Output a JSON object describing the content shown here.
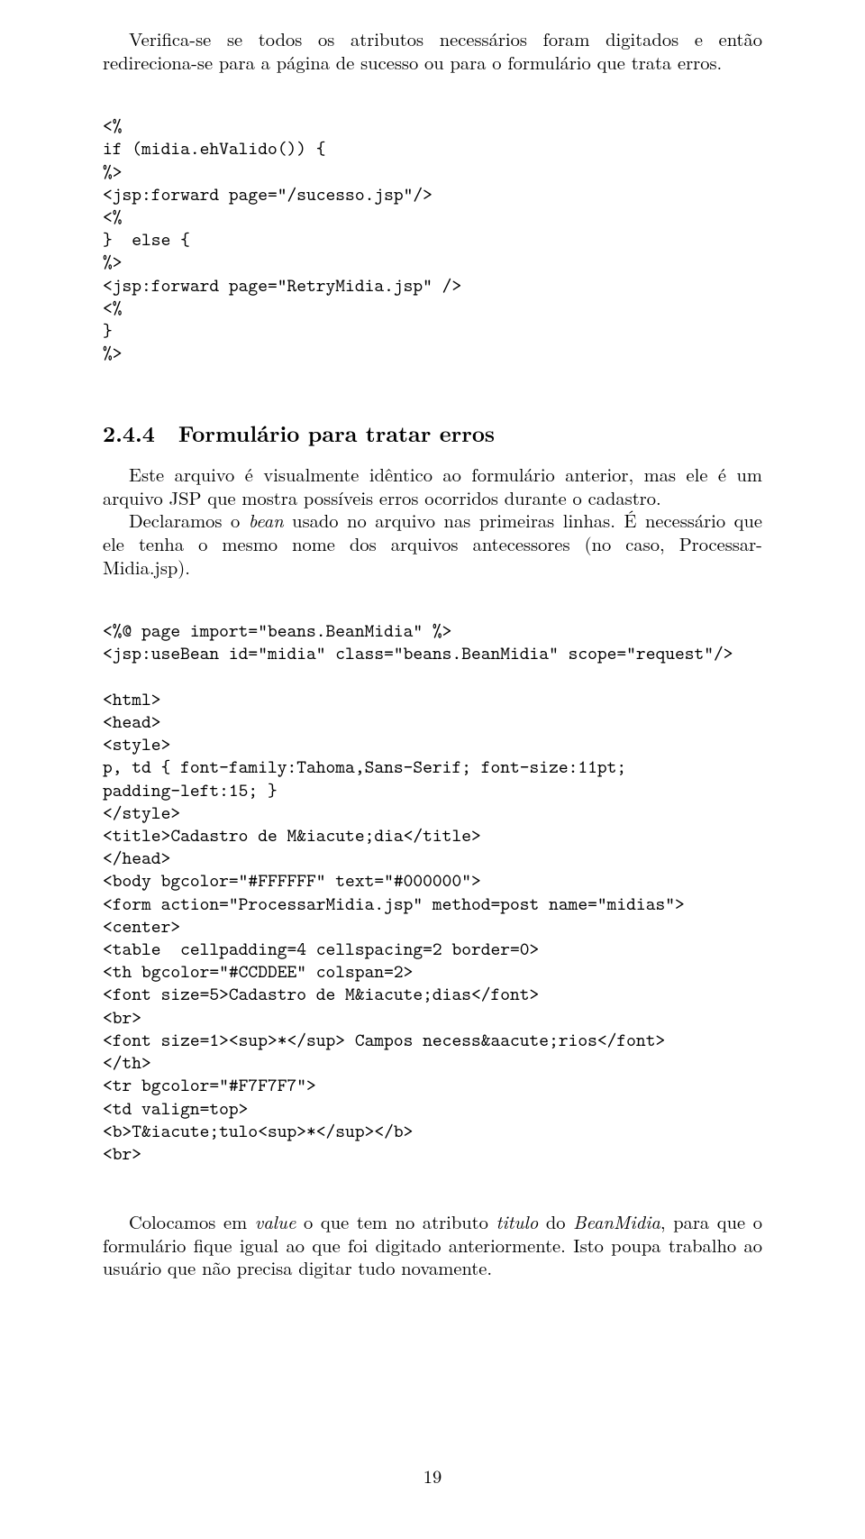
{
  "para1": "Verifica-se se todos os atributos necessários foram digitados e então redireciona-se para a página de sucesso ou para o formulário que trata erros.",
  "code1": "<%\nif (midia.ehValido()) {\n%>\n<jsp:forward page=\"/sucesso.jsp\"/>\n<%\n}  else {\n%>\n<jsp:forward page=\"RetryMidia.jsp\" />\n<%\n}\n%>",
  "section_num": "2.4.4",
  "section_title": "Formulário para tratar erros",
  "para2a": "Este arquivo é visualmente idêntico ao formulário anterior, mas ele é um arquivo JSP que mostra possíveis erros ocorridos durante o cadastro.",
  "para2b_pre": "Declaramos o ",
  "para2b_it": "bean",
  "para2b_post": " usado no arquivo nas primeiras linhas. É necessário que ele tenha o mesmo nome dos arquivos antecessores (no caso, Processar-Midia.jsp).",
  "code2": "<%@ page import=\"beans.BeanMidia\" %>\n<jsp:useBean id=\"midia\" class=\"beans.BeanMidia\" scope=\"request\"/>\n\n<html>\n<head>\n<style>\np, td { font-family:Tahoma,Sans-Serif; font-size:11pt;\npadding-left:15; }\n</style>\n<title>Cadastro de M&iacute;dia</title>\n</head>\n<body bgcolor=\"#FFFFFF\" text=\"#000000\">\n<form action=\"ProcessarMidia.jsp\" method=post name=\"midias\">\n<center>\n<table  cellpadding=4 cellspacing=2 border=0>\n<th bgcolor=\"#CCDDEE\" colspan=2>\n<font size=5>Cadastro de M&iacute;dias</font>\n<br>\n<font size=1><sup>*</sup> Campos necess&aacute;rios</font>\n</th>\n<tr bgcolor=\"#F7F7F7\">\n<td valign=top>\n<b>T&iacute;tulo<sup>*</sup></b>\n<br>",
  "para3_pre": "Colocamos em ",
  "para3_it1": "value",
  "para3_mid1": " o que tem no atributo ",
  "para3_it2": "titulo",
  "para3_mid2": " do ",
  "para3_it3": "BeanMidia",
  "para3_post": ", para que o formulário fique igual ao que foi digitado anteriormente. Isto poupa trabalho ao usuário que não precisa digitar tudo novamente.",
  "page_number": "19"
}
